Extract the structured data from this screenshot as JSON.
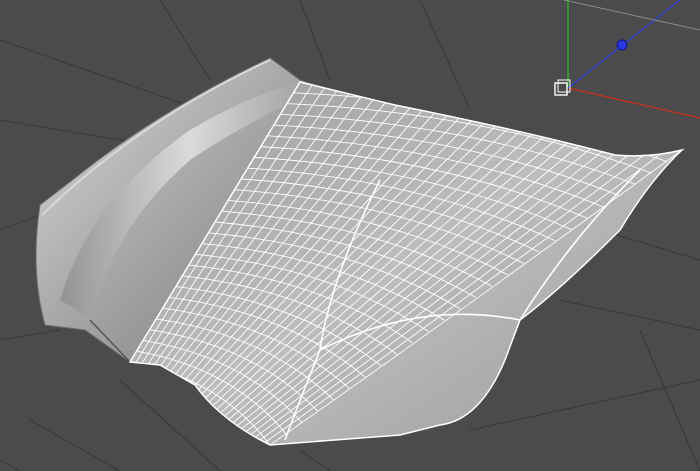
{
  "viewport": {
    "background": "#4b4b4b",
    "grid_color": "#3a3a3a",
    "object": {
      "name": "hood-mesh",
      "shaded_color": "#b9b9b9",
      "wire_color": "#ffffff"
    },
    "gizmo": {
      "x_axis_color": "#c8301e",
      "y_axis_color": "#30c030",
      "z_axis_color": "#2f3fd8",
      "handle_color": "#2a36e0",
      "pivot_color": "#ffffff"
    },
    "icons": [
      "move-gizmo-icon",
      "pivot-handle-icon",
      "z-axis-handle-icon"
    ]
  }
}
